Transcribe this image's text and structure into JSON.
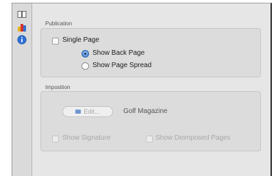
{
  "toolbar": {
    "items": [
      {
        "name": "book-icon"
      },
      {
        "name": "colors-icon"
      },
      {
        "name": "info-icon",
        "selected": true
      }
    ]
  },
  "publication": {
    "label": "Publication",
    "single_page_label": "Single Page",
    "single_page_checked": false,
    "show_back_page_label": "Show Back Page",
    "show_back_page_selected": true,
    "show_page_spread_label": "Show Page Spread",
    "show_page_spread_selected": false
  },
  "imposition": {
    "label": "Imposition",
    "edit_label": "Edit...",
    "document_name": "Golf Magazine",
    "show_signature_label": "Show Signature",
    "show_signature_checked": false,
    "show_deimposed_label": "Show Deimposed Pages",
    "show_deimposed_checked": false
  },
  "colors": {
    "accent": "#3a7ad2",
    "panel": "#e6e6e6",
    "group": "#dcdcdc"
  }
}
